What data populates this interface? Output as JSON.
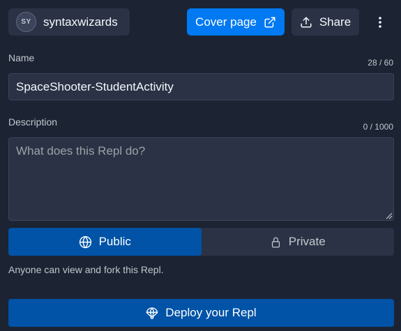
{
  "header": {
    "owner": {
      "initials": "SY",
      "username": "syntaxwizards"
    },
    "cover_page_label": "Cover page",
    "share_label": "Share"
  },
  "form": {
    "name": {
      "label": "Name",
      "counter": "28 / 60",
      "value": "SpaceShooter-StudentActivity"
    },
    "description": {
      "label": "Description",
      "counter": "0 / 1000",
      "value": "",
      "placeholder": "What does this Repl do?"
    }
  },
  "visibility": {
    "options": [
      {
        "label": "Public",
        "icon": "globe-icon",
        "selected": true
      },
      {
        "label": "Private",
        "icon": "lock-icon",
        "selected": false
      }
    ],
    "help_text": "Anyone can view and fork this Repl."
  },
  "deploy": {
    "label": "Deploy your Repl",
    "icon": "parachute-icon"
  },
  "colors": {
    "background": "#1c2333",
    "surface": "#2b3245",
    "accent": "#0079f2",
    "selected": "#0053a6",
    "text": "#f5f9fc",
    "muted": "#c2c8cc"
  }
}
